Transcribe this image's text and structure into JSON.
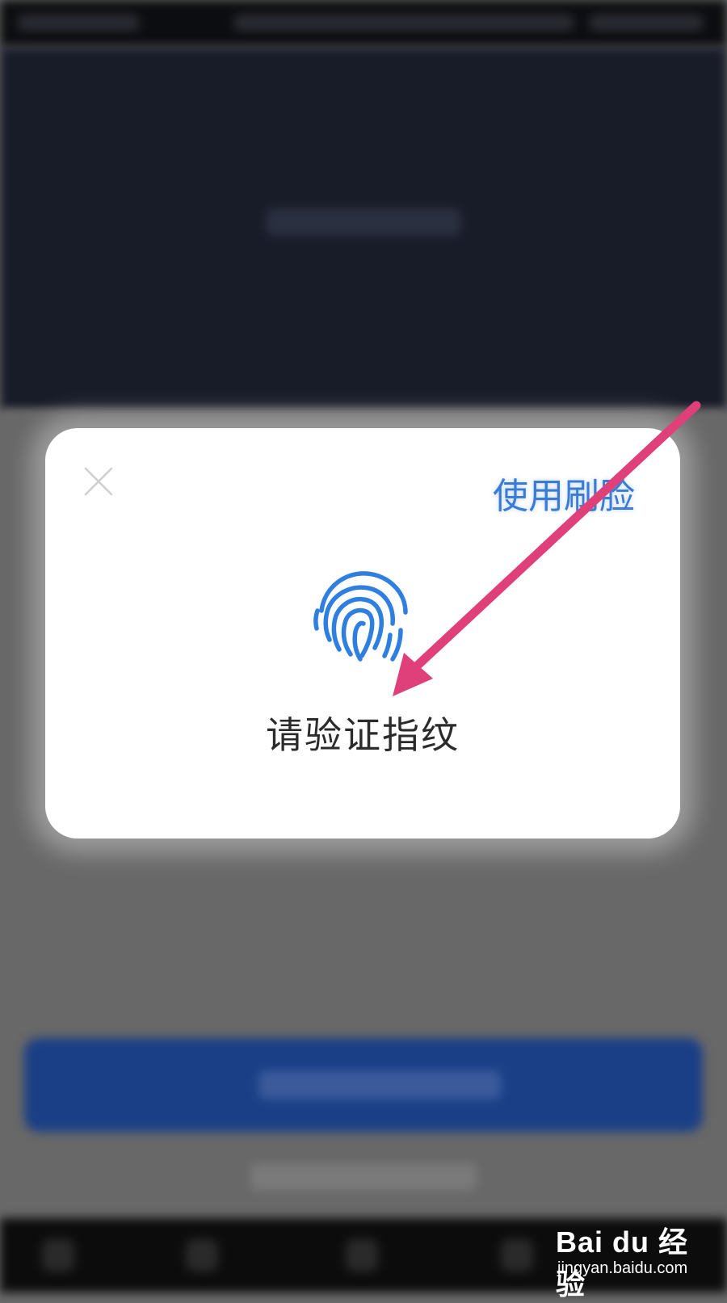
{
  "dialog": {
    "close_icon": "close-icon",
    "switch_label": "使用刷脸",
    "fingerprint_icon": "fingerprint-icon",
    "prompt": "请验证指纹",
    "accent_color": "#3a7bd5"
  },
  "annotation": {
    "arrow_color": "#e0407a",
    "arrow_icon": "arrow-icon"
  },
  "watermark": {
    "brand": "Bai du 经验",
    "url": "jingyan.baidu.com"
  }
}
